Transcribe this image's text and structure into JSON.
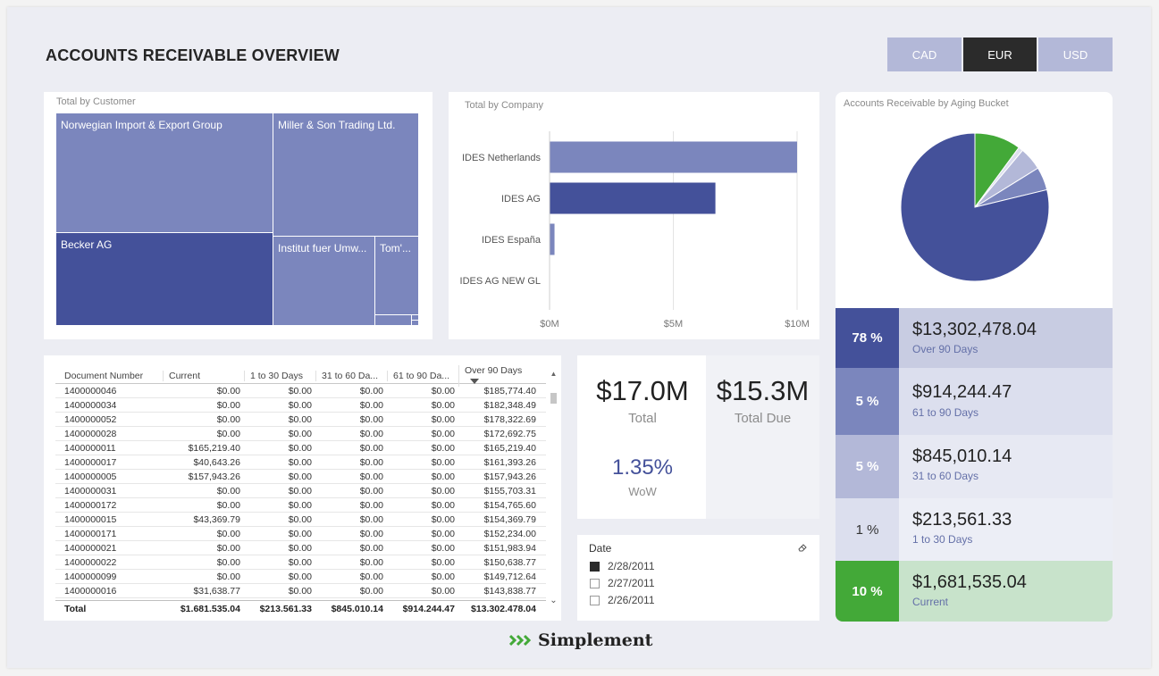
{
  "header": {
    "title": "ACCOUNTS RECEIVABLE OVERVIEW"
  },
  "currency": {
    "cad": "CAD",
    "eur": "EUR",
    "usd": "USD",
    "selected": "EUR"
  },
  "treemap": {
    "title": "Total by Customer",
    "cells": [
      "Norwegian Import & Export Group",
      "Miller & Son Trading Ltd.",
      "Becker AG",
      "Institut fuer Umw...",
      "Tom'..."
    ]
  },
  "company_chart": {
    "title": "Total by Company",
    "chart_data": {
      "type": "bar",
      "orientation": "horizontal",
      "categories": [
        "IDES Netherlands",
        "IDES AG",
        "IDES España",
        "IDES AG NEW GL"
      ],
      "values": [
        10.0,
        6.7,
        0.2,
        0.0
      ],
      "x_ticks": [
        "$0M",
        "$5M",
        "$10M"
      ],
      "xlim": [
        0,
        10
      ],
      "colors": [
        "#7b86bd",
        "#44519a",
        "#7b86bd",
        "#7b86bd"
      ],
      "grid": true
    }
  },
  "pie": {
    "title": "Accounts Receivable by Aging Bucket",
    "chart_data": {
      "type": "pie",
      "slices": [
        {
          "label": "Over 90 Days",
          "value": 78,
          "color": "#44519a"
        },
        {
          "label": "61 to 90 Days",
          "value": 5,
          "color": "#7b86bd"
        },
        {
          "label": "31 to 60 Days",
          "value": 5,
          "color": "#b3b8d8"
        },
        {
          "label": "1 to 30 Days",
          "value": 1,
          "color": "#dcdfee"
        },
        {
          "label": "Current",
          "value": 10,
          "color": "#43a938"
        }
      ]
    }
  },
  "table": {
    "headers": [
      "Document Number",
      "Current",
      "1 to 30 Days",
      "31 to 60 Da...",
      "61 to 90 Da...",
      "Over 90 Days"
    ],
    "rows": [
      [
        "1400000046",
        "$0.00",
        "$0.00",
        "$0.00",
        "$0.00",
        "$185,774.40"
      ],
      [
        "1400000034",
        "$0.00",
        "$0.00",
        "$0.00",
        "$0.00",
        "$182,348.49"
      ],
      [
        "1400000052",
        "$0.00",
        "$0.00",
        "$0.00",
        "$0.00",
        "$178,322.69"
      ],
      [
        "1400000028",
        "$0.00",
        "$0.00",
        "$0.00",
        "$0.00",
        "$172,692.75"
      ],
      [
        "1400000011",
        "$165,219.40",
        "$0.00",
        "$0.00",
        "$0.00",
        "$165,219.40"
      ],
      [
        "1400000017",
        "$40,643.26",
        "$0.00",
        "$0.00",
        "$0.00",
        "$161,393.26"
      ],
      [
        "1400000005",
        "$157,943.26",
        "$0.00",
        "$0.00",
        "$0.00",
        "$157,943.26"
      ],
      [
        "1400000031",
        "$0.00",
        "$0.00",
        "$0.00",
        "$0.00",
        "$155,703.31"
      ],
      [
        "1400000172",
        "$0.00",
        "$0.00",
        "$0.00",
        "$0.00",
        "$154,765.60"
      ],
      [
        "1400000015",
        "$43,369.79",
        "$0.00",
        "$0.00",
        "$0.00",
        "$154,369.79"
      ],
      [
        "1400000171",
        "$0.00",
        "$0.00",
        "$0.00",
        "$0.00",
        "$152,234.00"
      ],
      [
        "1400000021",
        "$0.00",
        "$0.00",
        "$0.00",
        "$0.00",
        "$151,983.94"
      ],
      [
        "1400000022",
        "$0.00",
        "$0.00",
        "$0.00",
        "$0.00",
        "$150,638.77"
      ],
      [
        "1400000099",
        "$0.00",
        "$0.00",
        "$0.00",
        "$0.00",
        "$149,712.64"
      ],
      [
        "1400000016",
        "$31,638.77",
        "$0.00",
        "$0.00",
        "$0.00",
        "$143,838.77"
      ]
    ],
    "total": [
      "Total",
      "$1.681.535.04",
      "$213.561.33",
      "$845.010.14",
      "$914.244.47",
      "$13.302.478.04"
    ]
  },
  "kpi": {
    "total_value": "$17.0M",
    "total_label": "Total",
    "due_value": "$15.3M",
    "due_label": "Total Due",
    "wow_value": "1.35%",
    "wow_label": "WoW"
  },
  "date_slicer": {
    "title": "Date",
    "options": [
      {
        "label": "2/28/2011",
        "checked": true
      },
      {
        "label": "2/27/2011",
        "checked": false
      },
      {
        "label": "2/26/2011",
        "checked": false
      }
    ]
  },
  "buckets": [
    {
      "pct": "78 %",
      "amount": "$13,302,478.04",
      "label": "Over 90 Days",
      "pct_color": "#44519a",
      "bg_color": "#c8cce2"
    },
    {
      "pct": "5 %",
      "amount": "$914,244.47",
      "label": "61 to 90 Days",
      "pct_color": "#7b86bd",
      "bg_color": "#dcdfee"
    },
    {
      "pct": "5 %",
      "amount": "$845,010.14",
      "label": "31 to 60 Days",
      "pct_color": "#b3b8d8",
      "bg_color": "#e7e9f3"
    },
    {
      "pct": "1 %",
      "amount": "$213,561.33",
      "label": "1 to 30 Days",
      "pct_color": "#dcdfee",
      "bg_color": "#eceef6"
    },
    {
      "pct": "10 %",
      "amount": "$1,681,535.04",
      "label": "Current",
      "pct_color": "#43a938",
      "bg_color": "#c8e3cb"
    }
  ],
  "brand": {
    "name": "Simplement"
  }
}
